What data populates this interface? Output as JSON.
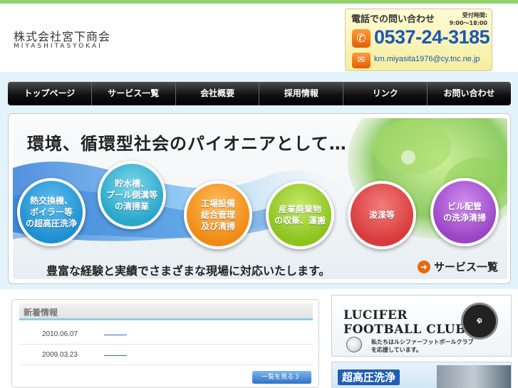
{
  "header": {
    "logo_jp": "株式会社宮下商会",
    "logo_en": "MIYASHITASYOKAI"
  },
  "contact": {
    "title": "電話での問い合わせ",
    "hours_label": "受付時間:",
    "hours": "9:00〜18:00",
    "tel": "0537-24-3185",
    "email": "km.miyasita1976@cy.tnc.ne.jp",
    "tel_icon": "phone-icon",
    "mail_icon": "mail-icon"
  },
  "nav": {
    "items": [
      {
        "label": "トップページ"
      },
      {
        "label": "サービス一覧"
      },
      {
        "label": "会社概要"
      },
      {
        "label": "採用情報"
      },
      {
        "label": "リンク"
      },
      {
        "label": "お問い合わせ"
      }
    ]
  },
  "hero": {
    "title": "環境、循環型社会のパイオニアとして…",
    "subtitle": "豊富な経験と実績でさまざまな現場に対応いたします。",
    "service_link": "サービス一覧",
    "circles": [
      {
        "label": "熱交換機、\nボイラー等\nの超高圧洗浄",
        "color": "#1f8fd1"
      },
      {
        "label": "貯水槽、\nプール側溝等\nの清掃業",
        "color": "#29a7c9"
      },
      {
        "label": "工場設備\n総合管理\n及び清掃",
        "color": "#ef8a14"
      },
      {
        "label": "産業廃棄物\nの収集、運搬",
        "color": "#8cc31e"
      },
      {
        "label": "浚渫等",
        "color": "#d83a3a"
      },
      {
        "label": "ビル配管\nの洗浄清掃",
        "color": "#9b45c6"
      }
    ]
  },
  "news": {
    "title": "新着情報",
    "items": [
      {
        "date": "2010.06.07"
      },
      {
        "date": "2009.03.23"
      }
    ],
    "more_label": "一覧を見る 》"
  },
  "banners": {
    "lucifer_title_1": "LUCIFER",
    "lucifer_title_2": "FOOTBALL CLUB",
    "lucifer_sub": "私たちはルシファーフットボールクラブ\nを応援しています。",
    "high_pressure": "超高圧洗浄"
  }
}
